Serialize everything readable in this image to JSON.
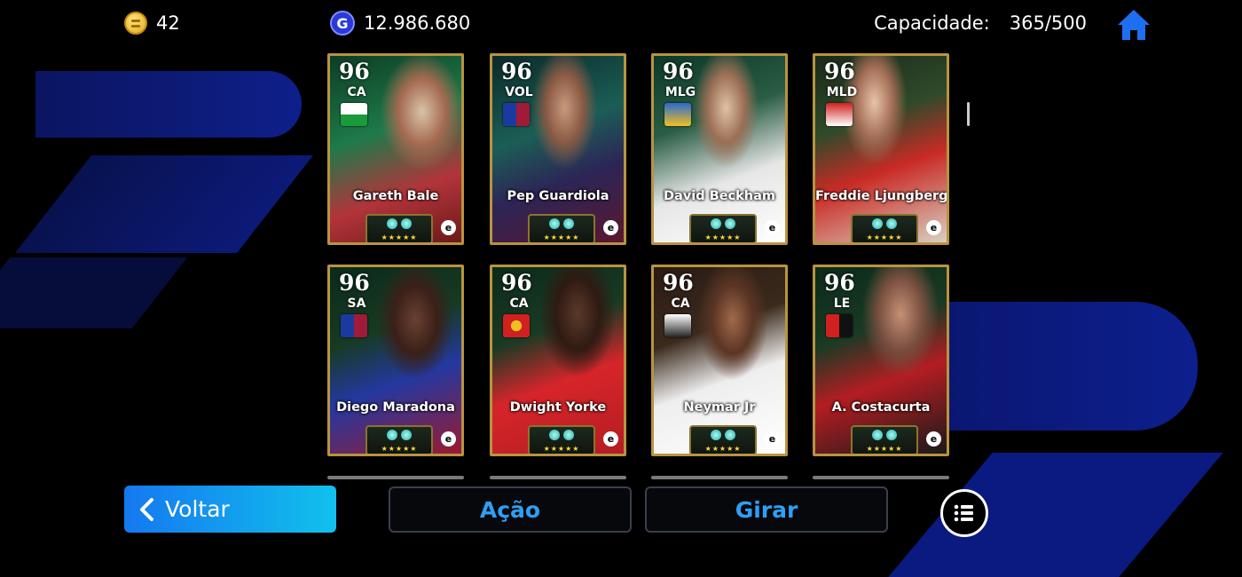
{
  "topbar": {
    "coins": "42",
    "gp": "12.986.680",
    "gp_icon_letter": "G",
    "capacity_label": "Capacidade:",
    "capacity_value": "365/500"
  },
  "cards": [
    {
      "rating": "96",
      "position": "CA",
      "name": "Gareth Bale",
      "stars": "★★★★★",
      "logo": "e"
    },
    {
      "rating": "96",
      "position": "VOL",
      "name": "Pep Guardiola",
      "stars": "★★★★★",
      "logo": "e"
    },
    {
      "rating": "96",
      "position": "MLG",
      "name": "David Beckham",
      "stars": "★★★★★",
      "logo": "e"
    },
    {
      "rating": "96",
      "position": "MLD",
      "name": "Freddie Ljungberg",
      "stars": "★★★★★",
      "logo": "e"
    },
    {
      "rating": "96",
      "position": "SA",
      "name": "Diego Maradona",
      "stars": "★★★★★",
      "logo": "e"
    },
    {
      "rating": "96",
      "position": "CA",
      "name": "Dwight Yorke",
      "stars": "★★★★★",
      "logo": "e"
    },
    {
      "rating": "96",
      "position": "CA",
      "name": "Neymar Jr",
      "stars": "★★★★★",
      "logo": "e"
    },
    {
      "rating": "96",
      "position": "LE",
      "name": "A. Costacurta",
      "stars": "★★★★★",
      "logo": "e"
    }
  ],
  "buttons": {
    "back": "Voltar",
    "action": "Ação",
    "rotate": "Girar"
  },
  "icons": [
    "coin-icon",
    "gp-icon",
    "home-icon",
    "chevron-left-icon",
    "list-menu-icon",
    "efootball-logo-icon"
  ],
  "colors": {
    "accent_blue": "#2f9ff5",
    "back_button_start": "#1578f0",
    "back_button_end": "#11c1ec",
    "card_border": "#b89440"
  }
}
